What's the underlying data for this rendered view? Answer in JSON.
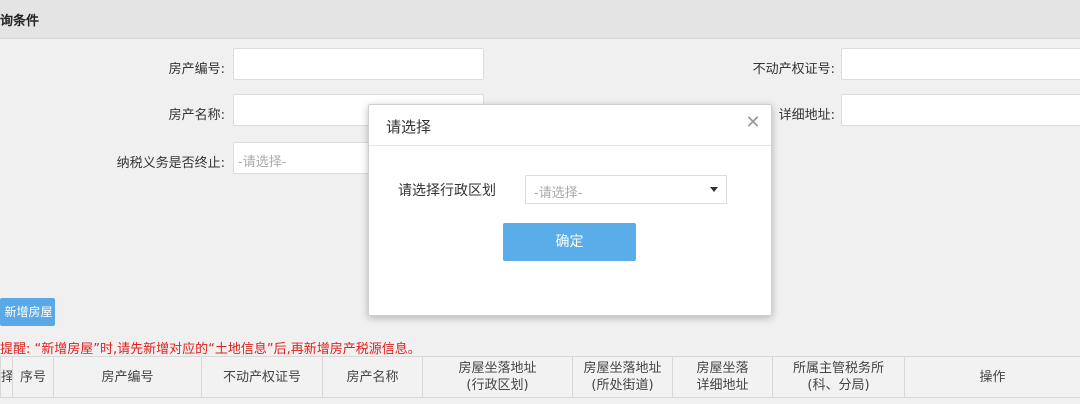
{
  "section": {
    "title": "询条件"
  },
  "form": {
    "house_no_label": "房产编号:",
    "house_name_label": "房产名称:",
    "tax_end_label": "纳税义务是否终止:",
    "tax_end_placeholder": "-请选择-",
    "property_cert_label": "不动产权证号:",
    "address_label": "详细地址:"
  },
  "actions": {
    "add_house": "新增房屋"
  },
  "notice": "提醒: “新增房屋”时,请先新增对应的“土地信息”后,再新增房产税源信息。",
  "table": {
    "headers": [
      [
        "择"
      ],
      [
        "序号"
      ],
      [
        "房产编号"
      ],
      [
        "不动产权证号"
      ],
      [
        "房产名称"
      ],
      [
        "房屋坐落地址",
        "(行政区划)"
      ],
      [
        "房屋坐落地址",
        "(所处街道)"
      ],
      [
        "房屋坐落",
        "详细地址"
      ],
      [
        "所属主管税务所",
        "(科、分局)"
      ],
      [
        "操作"
      ]
    ]
  },
  "modal": {
    "title": "请选择",
    "region_label": "请选择行政区划",
    "region_placeholder": "-请选择-",
    "confirm_label": "确定"
  }
}
